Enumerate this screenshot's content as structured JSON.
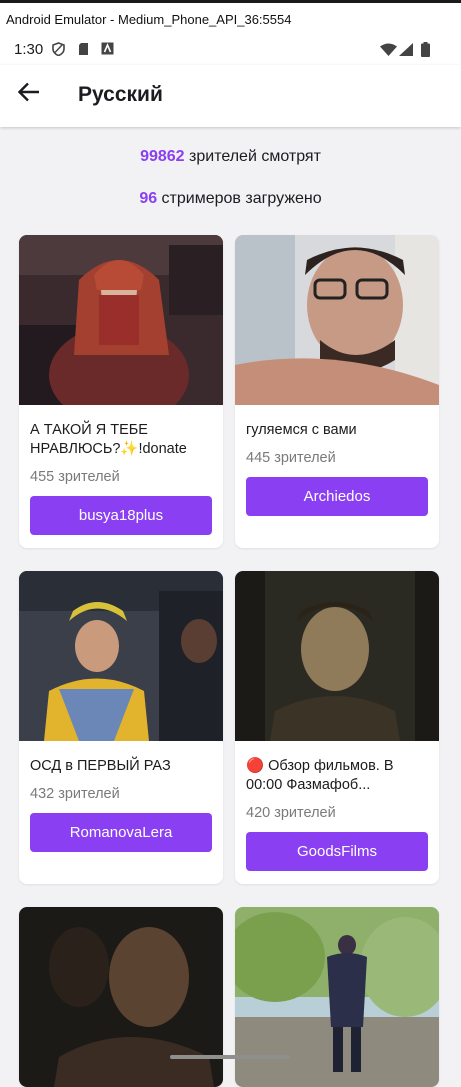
{
  "window": {
    "title": "Android Emulator - Medium_Phone_API_36:5554"
  },
  "status_bar": {
    "time": "1:30"
  },
  "app_bar": {
    "title": "Русский"
  },
  "stats": {
    "viewers_count": "99862",
    "viewers_text": " зрителей смотрят",
    "streamers_count": "96",
    "streamers_text": " стримеров загружено"
  },
  "streams": [
    {
      "title": "А ТАКОЙ Я ТЕБЕ НРАВЛЮСЬ?✨!donate",
      "viewers": "455 зрителей",
      "channel": "busya18plus"
    },
    {
      "title": "гуляемся с вами",
      "viewers": "445 зрителей",
      "channel": "Archiedos"
    },
    {
      "title": "ОСД в ПЕРВЫЙ РАЗ",
      "viewers": "432 зрителей",
      "channel": "RomanovaLera"
    },
    {
      "title": "🔴 Обзор фильмов. В 00:00 Фазмафоб...",
      "viewers": "420 зрителей",
      "channel": "GoodsFilms"
    },
    {
      "title": "",
      "viewers": "",
      "channel": ""
    },
    {
      "title": "",
      "viewers": "",
      "channel": ""
    }
  ],
  "colors": {
    "accent": "#8a3ff2",
    "background": "#f2f2f4"
  }
}
